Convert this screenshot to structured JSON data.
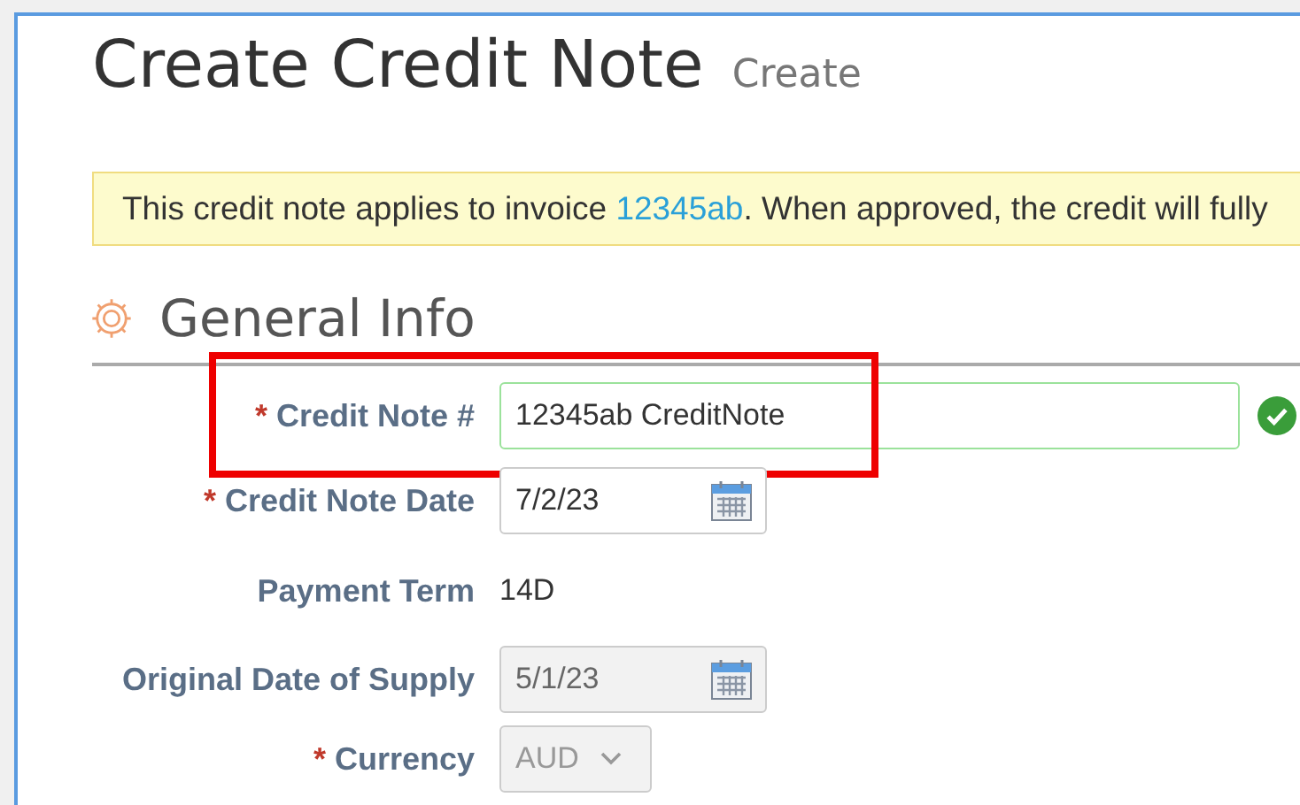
{
  "header": {
    "title": "Create Credit Note",
    "subtitle": "Create"
  },
  "notice": {
    "text": "This credit note applies to invoice ",
    "link": "12345ab",
    "rest": ". When approved, the credit will fully"
  },
  "section": {
    "title": "General Info"
  },
  "fields": [
    {
      "label": "Credit Note #",
      "required_mark": "*",
      "kind": "text",
      "value": "12345ab CreditNote",
      "valid": true,
      "disabled": false,
      "highlighted": true
    },
    {
      "label": "Credit Note Date",
      "required_mark": "*",
      "kind": "date",
      "value": "7/2/23",
      "valid": false,
      "disabled": false,
      "highlighted": false
    },
    {
      "label": "Payment Term",
      "kind": "readonly",
      "value": "14D"
    },
    {
      "label": "Original Date of Supply",
      "kind": "date",
      "value": "5/1/23",
      "valid": false,
      "disabled": true,
      "highlighted": false
    },
    {
      "label": "Currency",
      "required_mark": "*",
      "kind": "select",
      "value": "AUD",
      "valid": false,
      "disabled": true,
      "highlighted": false
    }
  ]
}
